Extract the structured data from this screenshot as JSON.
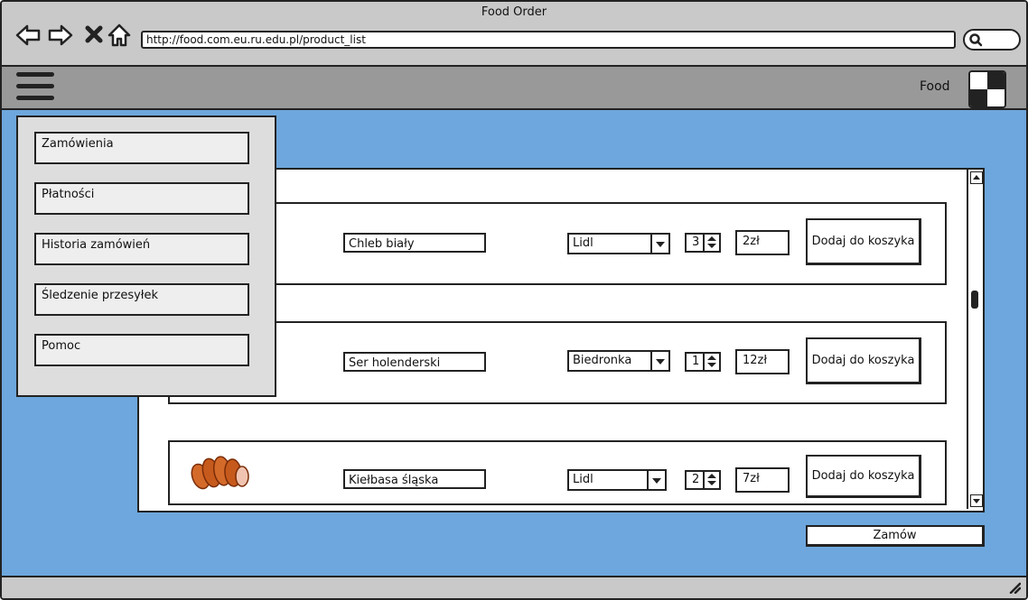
{
  "window": {
    "title": "Food Order"
  },
  "browser": {
    "url": "http://food.com.eu.ru.edu.pl/product_list"
  },
  "header": {
    "brand": "Food"
  },
  "menu": {
    "items": [
      {
        "label": "Zamówienia"
      },
      {
        "label": "Płatności"
      },
      {
        "label": "Historia zamówień"
      },
      {
        "label": "Śledzenie przesyłek"
      },
      {
        "label": "Pomoc"
      }
    ]
  },
  "products": [
    {
      "name": "Chleb biały",
      "shop": "Lidl",
      "quantity": "3",
      "price": "2zł",
      "button": "Dodaj do koszyka"
    },
    {
      "name": "Ser holenderski",
      "shop": "Biedronka",
      "quantity": "1",
      "price": "12zł",
      "button": "Dodaj do koszyka"
    },
    {
      "name": "Kiełbasa śląska",
      "shop": "Lidl",
      "quantity": "2",
      "price": "7zł",
      "button": "Dodaj do koszyka"
    }
  ],
  "order_button": "Zamów"
}
